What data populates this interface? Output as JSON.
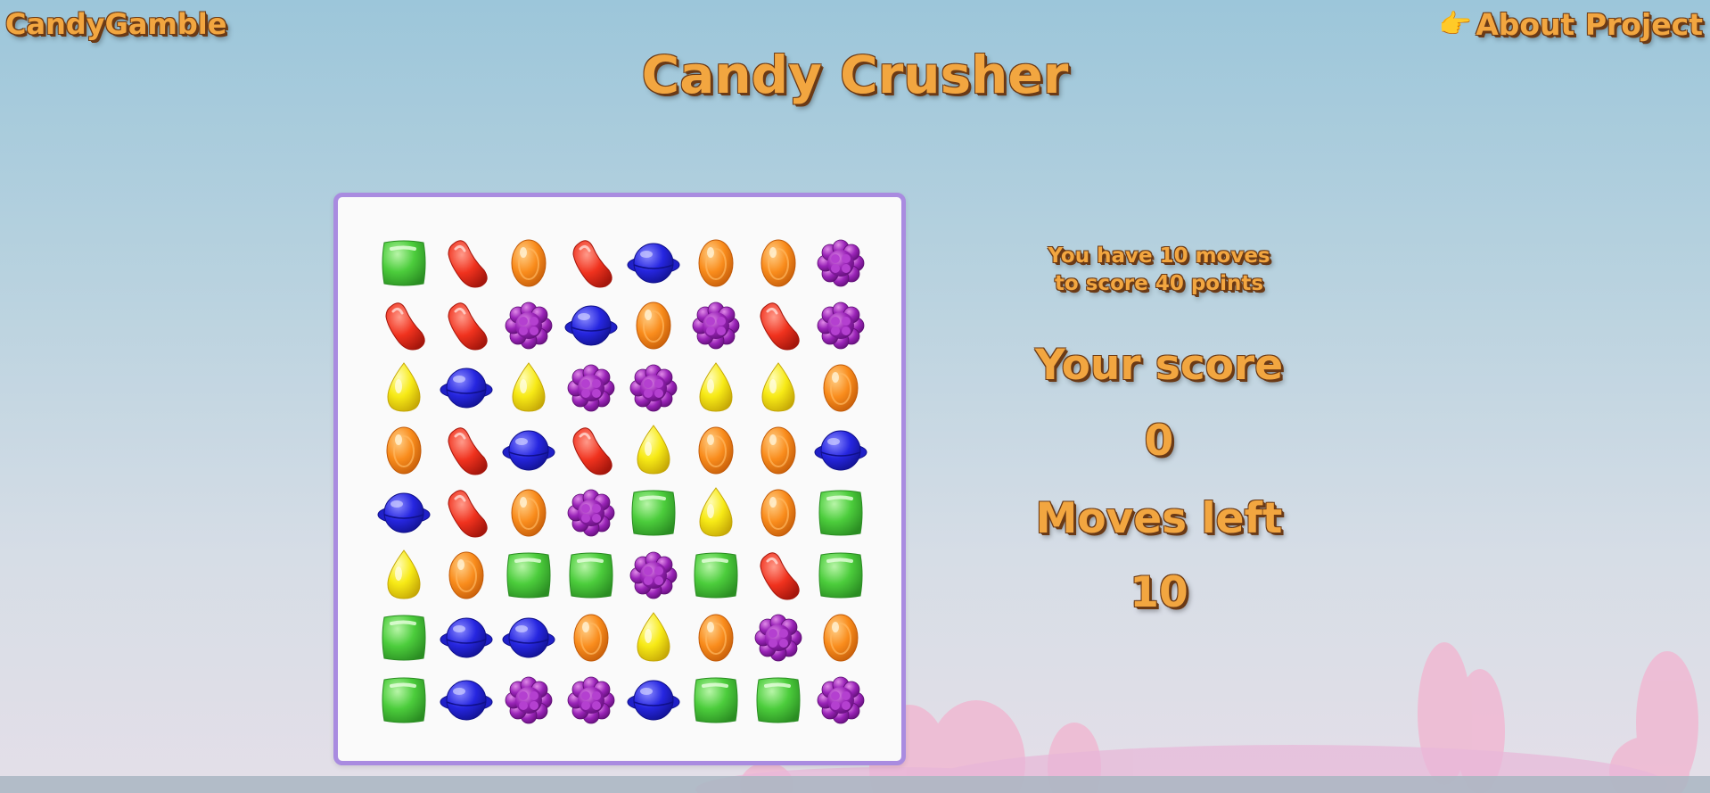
{
  "header": {
    "brand": "CandyGamble",
    "about_label": "About Project",
    "about_icon": "pointing-hand-icon",
    "title": "Candy Crusher"
  },
  "colors": {
    "text_fill": "#f2a640",
    "text_outline": "#6b3a16",
    "board_border": "#a98be0",
    "board_bg": "#fafafa"
  },
  "board": {
    "rows": 8,
    "cols": 8,
    "grid": [
      [
        "green",
        "red",
        "orange",
        "red",
        "blue",
        "orange",
        "orange",
        "purple"
      ],
      [
        "red",
        "red",
        "purple",
        "blue",
        "orange",
        "purple",
        "red",
        "purple"
      ],
      [
        "yellow",
        "blue",
        "yellow",
        "purple",
        "purple",
        "yellow",
        "yellow",
        "orange"
      ],
      [
        "orange",
        "red",
        "blue",
        "red",
        "yellow",
        "orange",
        "orange",
        "blue"
      ],
      [
        "blue",
        "red",
        "orange",
        "purple",
        "green",
        "yellow",
        "orange",
        "green"
      ],
      [
        "yellow",
        "orange",
        "green",
        "green",
        "purple",
        "green",
        "red",
        "green"
      ],
      [
        "green",
        "blue",
        "blue",
        "orange",
        "yellow",
        "orange",
        "purple",
        "orange"
      ],
      [
        "green",
        "blue",
        "purple",
        "purple",
        "blue",
        "green",
        "green",
        "purple"
      ]
    ]
  },
  "panel": {
    "goal_text": "You have 10 moves to score 40 points",
    "score_label": "Your score",
    "score": "0",
    "moves_label": "Moves left",
    "moves": "10"
  }
}
